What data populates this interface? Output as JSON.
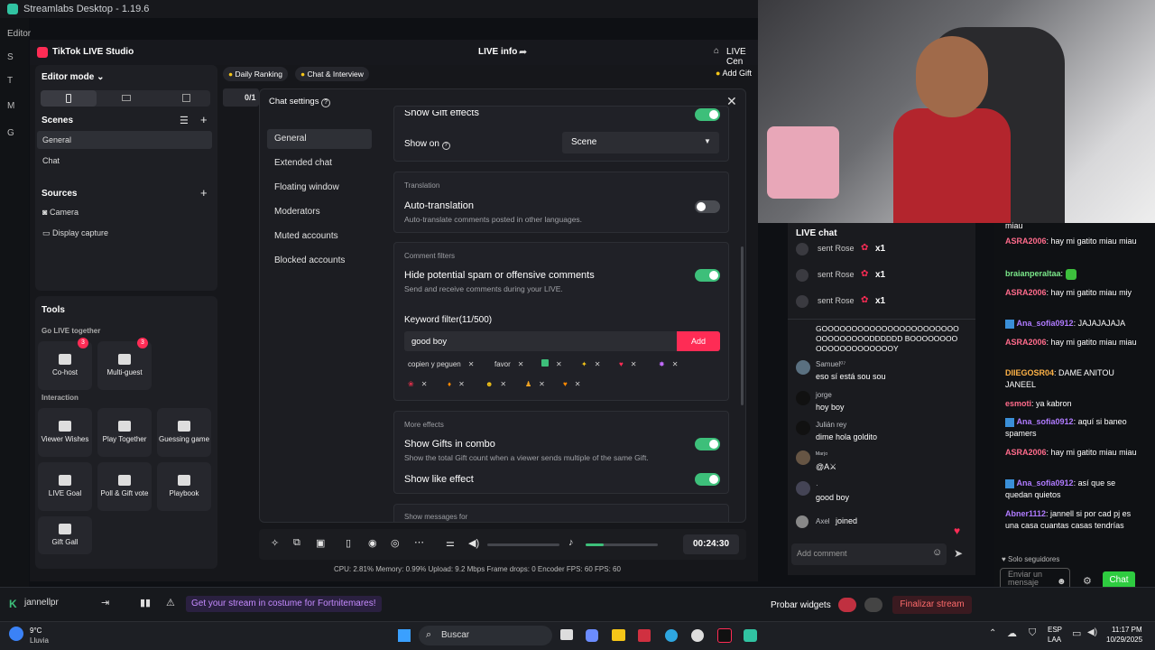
{
  "streamlabs": {
    "title": "Streamlabs Desktop - 1.19.6",
    "nav": [
      "Editor",
      "S",
      "T",
      "M",
      "G"
    ],
    "user": "jannellpr",
    "promo": "Get your stream in costume for Fortnitemares!",
    "probar_widgets": "Probar widgets",
    "finalizar": "Finalizar stream",
    "stats": "CPU: 2.81%   Memory: 0.99%   Upload: 9.2 Mbps   Frame drops: 0   Encoder FPS: 60   FPS: 60"
  },
  "studio": {
    "app_name": "TikTok LIVE Studio",
    "live_info": "LIVE info",
    "live_center": "LIVE Cen",
    "add_gift": "Add Gift",
    "editor_mode": "Editor mode",
    "scenes_title": "Scenes",
    "scenes": [
      "General",
      "Chat"
    ],
    "sources_title": "Sources",
    "sources": [
      "Camera",
      "Display capture"
    ],
    "tools_title": "Tools",
    "go_live_together": "Go LIVE together",
    "cohost": "Co-host",
    "multiguest": "Multi-guest",
    "cohost_badge": "3",
    "multiguest_badge": "3",
    "interaction": "Interaction",
    "tools": [
      "Viewer Wishes",
      "Play Together",
      "Guessing game",
      "LIVE Goal",
      "Poll & Gift vote",
      "Playbook"
    ],
    "gift_gallery": "Gift Gall",
    "daily_ranking": "Daily Ranking",
    "chat_interview": "Chat & Interview",
    "timer": "00:24:30",
    "viewer_count_partial": "0/1"
  },
  "chat_settings": {
    "title": "Chat settings",
    "nav": [
      "General",
      "Extended chat",
      "Floating window",
      "Moderators",
      "Muted accounts",
      "Blocked accounts"
    ],
    "show_gift_effects": "Show Gift effects",
    "show_on_label": "Show on",
    "show_on_value": "Scene",
    "translation_title": "Translation",
    "auto_translation": "Auto-translation",
    "auto_translation_desc": "Auto-translate comments posted in other languages.",
    "comment_filters_title": "Comment filters",
    "hide_spam": "Hide potential spam or offensive comments",
    "hide_spam_desc": "Send and receive comments during your LIVE.",
    "keyword_filter": "Keyword filter(11/500)",
    "keyword_input": "good boy",
    "add_button": "Add",
    "keywords": [
      "copien y peguen",
      "favor"
    ],
    "more_effects_title": "More effects",
    "show_gifts_combo": "Show Gifts in combo",
    "show_gifts_combo_desc": "Show the total Gift count when a viewer sends multiple of the same Gift.",
    "show_like_effect": "Show like effect",
    "show_messages_for": "Show messages for"
  },
  "live_chat": {
    "title": "LIVE chat",
    "gifts": [
      {
        "text": "sent Rose",
        "count": "x1"
      },
      {
        "text": "sent Rose",
        "count": "x1"
      },
      {
        "text": "sent Rose",
        "count": "x1"
      }
    ],
    "messages": [
      {
        "name": "",
        "text": "GOOOOOOOOOOOOOOOOOOOOOOOOOOOOOOOODDDDDD BOOOOOOOOOOOOOOOOOOOOOY"
      },
      {
        "name": "Samuel⁰⁷",
        "text": "eso sí está sou sou"
      },
      {
        "name": "jorge",
        "text": "hoy boy"
      },
      {
        "name": "Julián rey",
        "text": "dime hola goldito"
      },
      {
        "name": "ᴹᵃʳʲᵒ",
        "text": "@A⚔"
      },
      {
        "name": "·",
        "text": "good boy"
      }
    ],
    "joined_name": "Axel",
    "joined_text": "joined",
    "add_comment": "Add comment"
  },
  "sl_chat": {
    "messages": [
      {
        "user": "",
        "text": "miau",
        "color": "#ffffff"
      },
      {
        "user": "ASRA2006",
        "text": ": hay mi gatito miau miau",
        "color": "#ff6b8b"
      },
      {
        "user": "braianperaltaa",
        "text": ":",
        "color": "#7be88a"
      },
      {
        "user": "ASRA2006",
        "text": ": hay mi gatito miau miy",
        "color": "#ff6b8b"
      },
      {
        "user": "Ana_sofia0912",
        "text": ": JAJAJAJAJA",
        "color": "#b07bff"
      },
      {
        "user": "ASRA2006",
        "text": ": hay mi gatito miau miau",
        "color": "#ff6b8b"
      },
      {
        "user": "DIIEGOSR04",
        "text": ": DAME ANITOU JANEEL",
        "color": "#ffb347"
      },
      {
        "user": "esmoti",
        "text": ": ya kabron",
        "color": "#ff6b8b"
      },
      {
        "user": "Ana_sofia0912",
        "text": ": aquí si baneo spamers",
        "color": "#b07bff"
      },
      {
        "user": "ASRA2006",
        "text": ": hay mi gatito miau miau",
        "color": "#ff6b8b"
      },
      {
        "user": "Ana_sofia0912",
        "text": ": así que se quedan quietos",
        "color": "#b07bff"
      },
      {
        "user": "Abner1112",
        "text": ": jannell si por cad pj es una casa cuantas casas tendrías",
        "color": "#b07bff"
      }
    ],
    "followers_only": "Solo seguidores",
    "input_placeholder": "Enviar un mensaje",
    "chat_button": "Chat"
  },
  "taskbar": {
    "weather_temp": "9°C",
    "weather_desc": "Lluvia",
    "search": "Buscar",
    "lang": "ESP",
    "lang2": "LAA",
    "time": "11:17 PM",
    "date": "10/29/2025"
  },
  "colors": {
    "accent": "#fe2c55",
    "toggle_on": "#3dbf7a",
    "sl_green": "#31c3a2",
    "chat_btn": "#2ecc40"
  }
}
